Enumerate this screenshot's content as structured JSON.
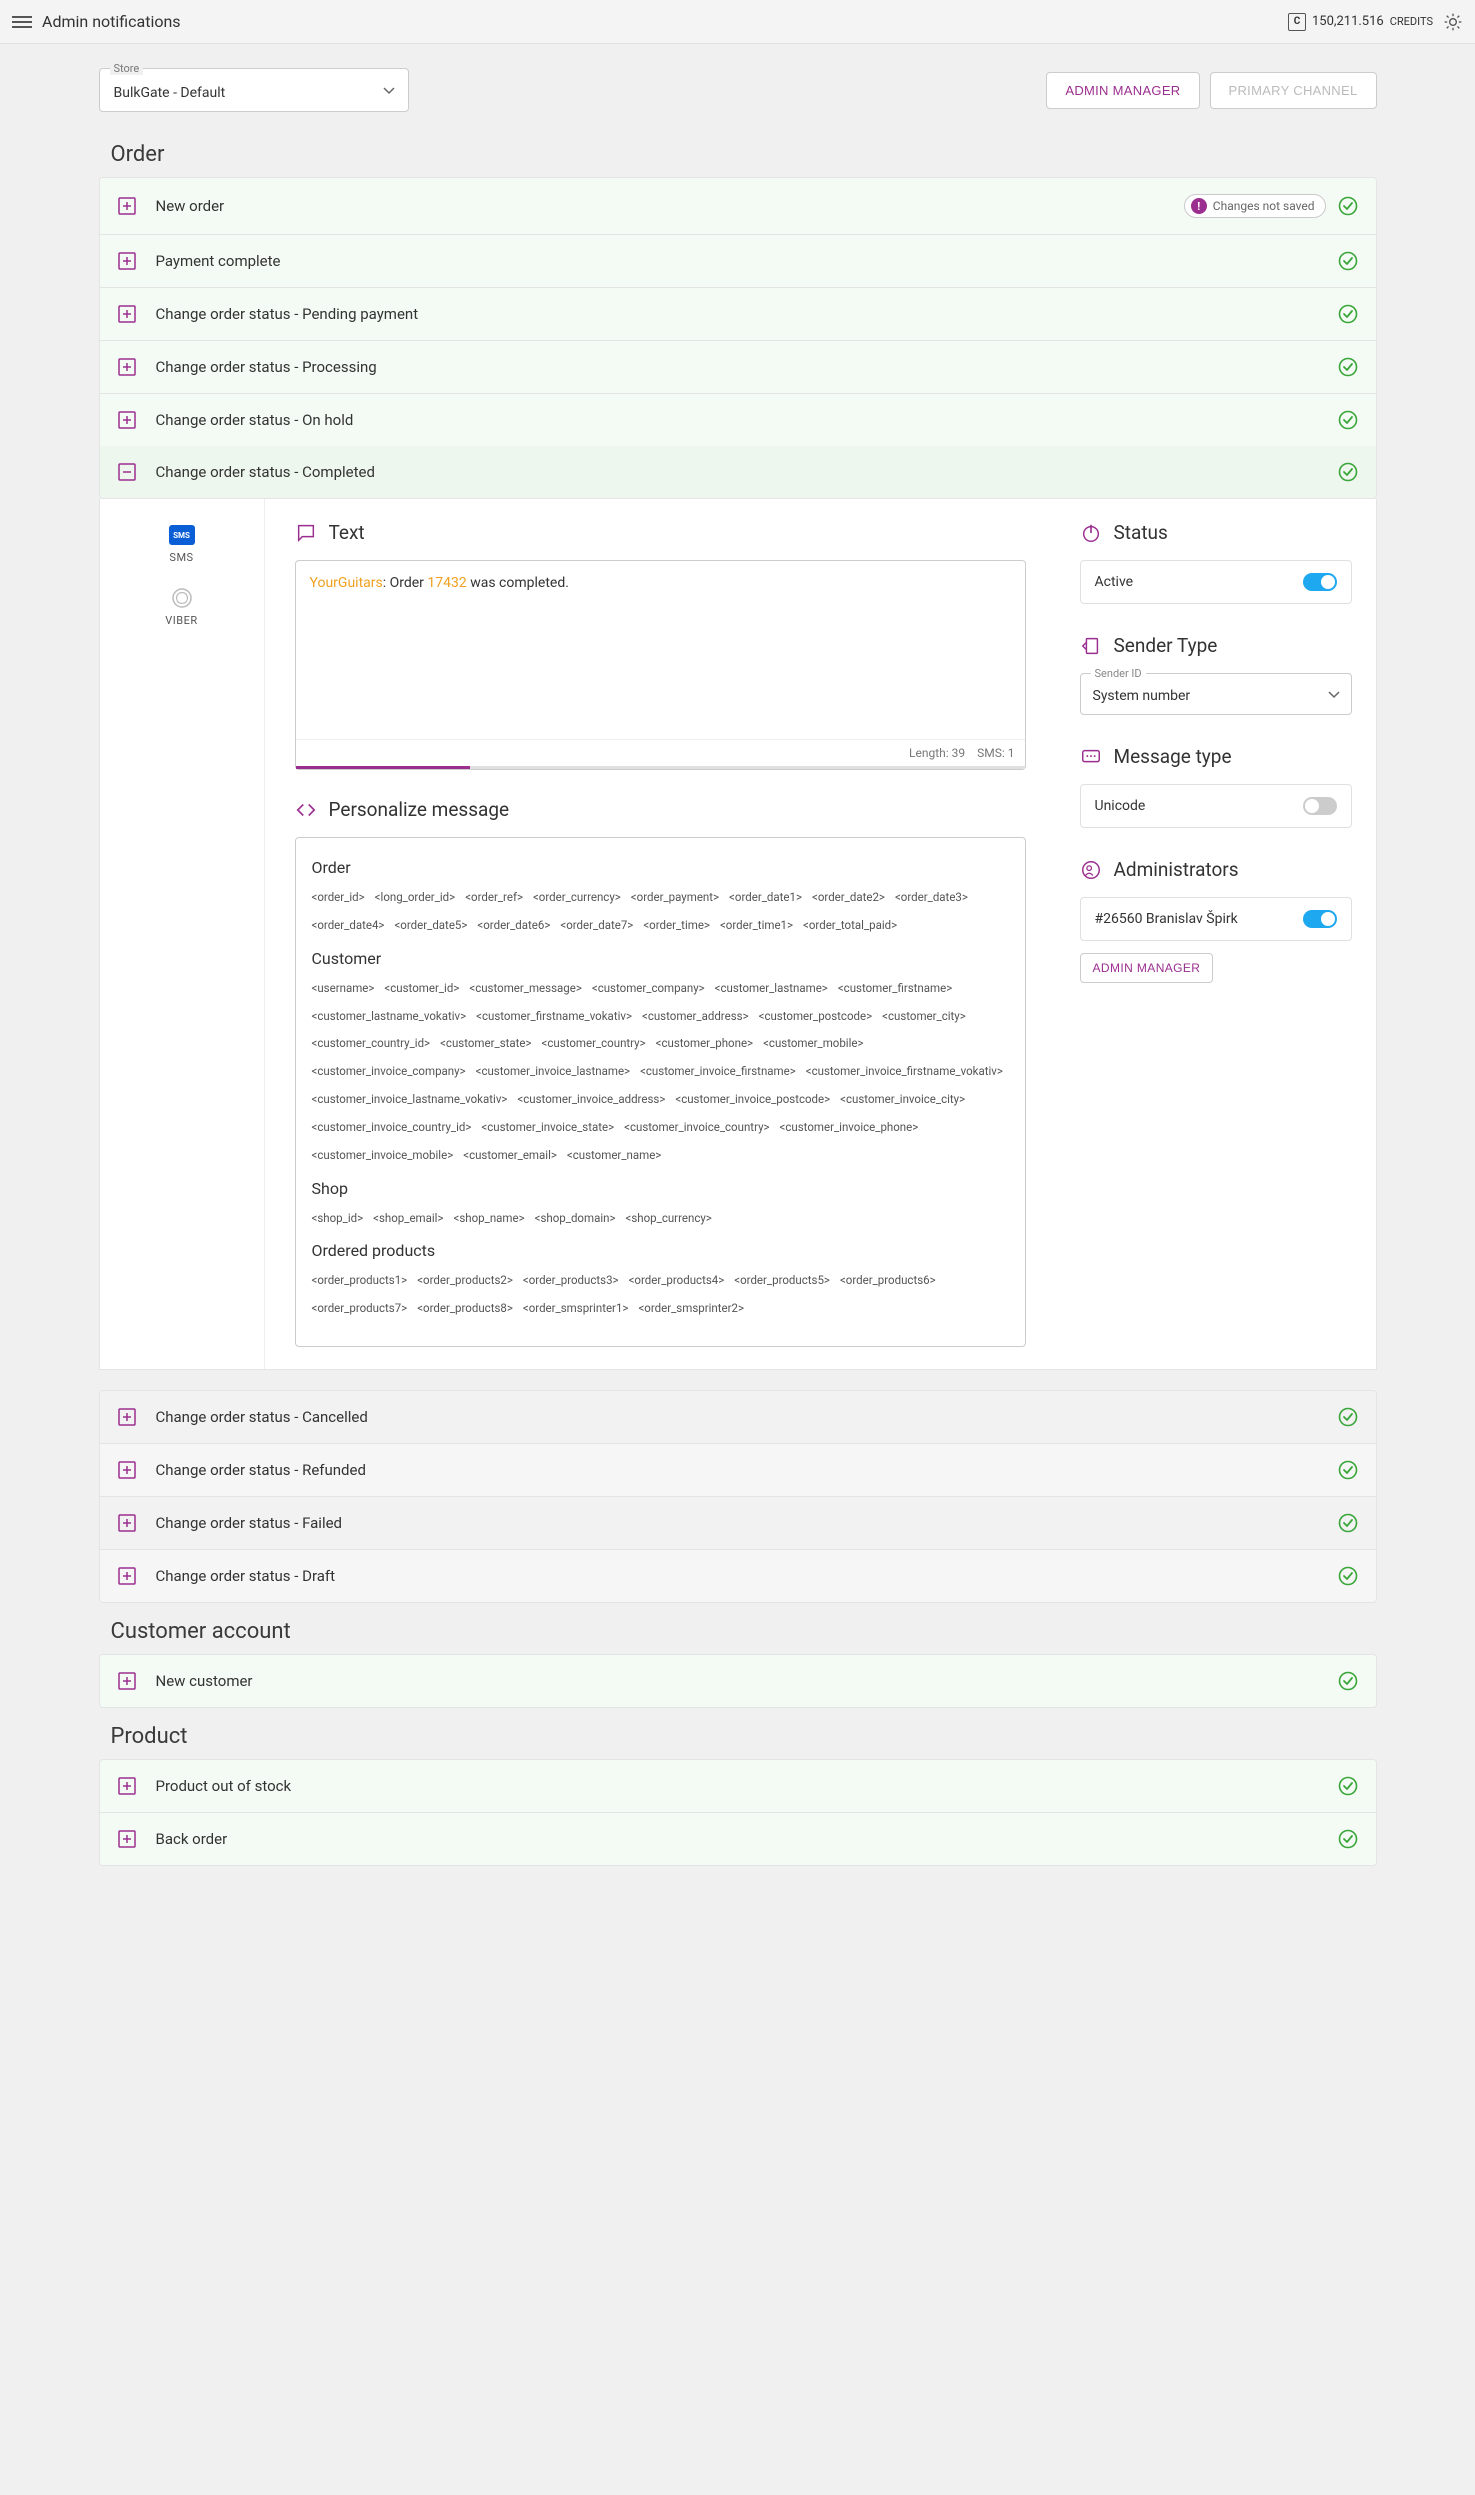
{
  "header": {
    "title": "Admin notifications",
    "credits_value": "150,211.516",
    "credits_label": "CREDITS"
  },
  "store": {
    "label": "Store",
    "value": "BulkGate - Default"
  },
  "buttons": {
    "admin_manager": "ADMIN MANAGER",
    "primary_channel": "PRIMARY CHANNEL"
  },
  "sections": {
    "order": "Order",
    "customer_account": "Customer account",
    "product": "Product"
  },
  "order_rows": [
    {
      "label": "New order",
      "changes_badge": "Changes not saved"
    },
    {
      "label": "Payment complete"
    },
    {
      "label": "Change order status - Pending payment"
    },
    {
      "label": "Change order status - Processing"
    },
    {
      "label": "Change order status - On hold"
    }
  ],
  "expanded_row": {
    "label": "Change order status - Completed"
  },
  "order_rows_after": [
    {
      "label": "Change order status - Cancelled"
    },
    {
      "label": "Change order status - Refunded"
    },
    {
      "label": "Change order status - Failed"
    },
    {
      "label": "Change order status - Draft"
    }
  ],
  "customer_rows": [
    {
      "label": "New customer"
    }
  ],
  "product_rows": [
    {
      "label": "Product out of stock"
    },
    {
      "label": "Back order"
    }
  ],
  "channels": {
    "sms": "SMS",
    "viber": "VIBER"
  },
  "editor": {
    "heading": "Text",
    "brand": "YourGuitars",
    "sep": ": ",
    "t1": "Order ",
    "order_id": "17432",
    "t2": " was completed.",
    "length_label": "Length: 39",
    "sms_label": "SMS: 1"
  },
  "personalize": {
    "heading": "Personalize message",
    "groups": [
      {
        "title": "Order",
        "vars": [
          "<order_id>",
          "<long_order_id>",
          "<order_ref>",
          "<order_currency>",
          "<order_payment>",
          "<order_date1>",
          "<order_date2>",
          "<order_date3>",
          "<order_date4>",
          "<order_date5>",
          "<order_date6>",
          "<order_date7>",
          "<order_time>",
          "<order_time1>",
          "<order_total_paid>"
        ]
      },
      {
        "title": "Customer",
        "vars": [
          "<username>",
          "<customer_id>",
          "<customer_message>",
          "<customer_company>",
          "<customer_lastname>",
          "<customer_firstname>",
          "<customer_lastname_vokativ>",
          "<customer_firstname_vokativ>",
          "<customer_address>",
          "<customer_postcode>",
          "<customer_city>",
          "<customer_country_id>",
          "<customer_state>",
          "<customer_country>",
          "<customer_phone>",
          "<customer_mobile>",
          "<customer_invoice_company>",
          "<customer_invoice_lastname>",
          "<customer_invoice_firstname>",
          "<customer_invoice_firstname_vokativ>",
          "<customer_invoice_lastname_vokativ>",
          "<customer_invoice_address>",
          "<customer_invoice_postcode>",
          "<customer_invoice_city>",
          "<customer_invoice_country_id>",
          "<customer_invoice_state>",
          "<customer_invoice_country>",
          "<customer_invoice_phone>",
          "<customer_invoice_mobile>",
          "<customer_email>",
          "<customer_name>"
        ]
      },
      {
        "title": "Shop",
        "vars": [
          "<shop_id>",
          "<shop_email>",
          "<shop_name>",
          "<shop_domain>",
          "<shop_currency>"
        ]
      },
      {
        "title": "Ordered products",
        "vars": [
          "<order_products1>",
          "<order_products2>",
          "<order_products3>",
          "<order_products4>",
          "<order_products5>",
          "<order_products6>",
          "<order_products7>",
          "<order_products8>",
          "<order_smsprinter1>",
          "<order_smsprinter2>"
        ]
      }
    ]
  },
  "side": {
    "status_heading": "Status",
    "status_label": "Active",
    "sender_heading": "Sender Type",
    "sender_label": "Sender ID",
    "sender_value": "System number",
    "msgtype_heading": "Message type",
    "msgtype_label": "Unicode",
    "admins_heading": "Administrators",
    "admin_row": "#26560 Branislav Špirk",
    "admin_manager_btn": "ADMIN MANAGER"
  }
}
